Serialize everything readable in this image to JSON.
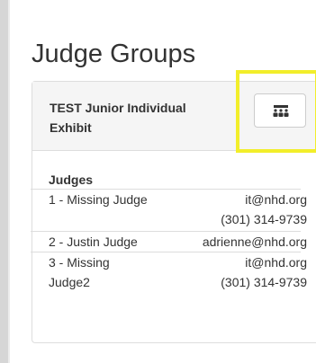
{
  "page": {
    "title": "Judge Groups"
  },
  "group": {
    "name": "TEST Junior Individual Exhibit",
    "button_icon": "group-icon"
  },
  "judges": {
    "header": "Judges",
    "rows": [
      {
        "name": "1 - Missing Judge",
        "email": "it@nhd.org",
        "phone": "(301) 314-9739"
      },
      {
        "name": "2 - Justin Judge",
        "email": "adrienne@nhd.org",
        "phone": ""
      },
      {
        "name": "3 - Missing Judge2",
        "email": "it@nhd.org",
        "phone": "(301) 314-9739"
      }
    ]
  },
  "colors": {
    "highlight": "#f2ee2a",
    "heading_bg": "#f5f5f5",
    "border": "#dddddd"
  }
}
